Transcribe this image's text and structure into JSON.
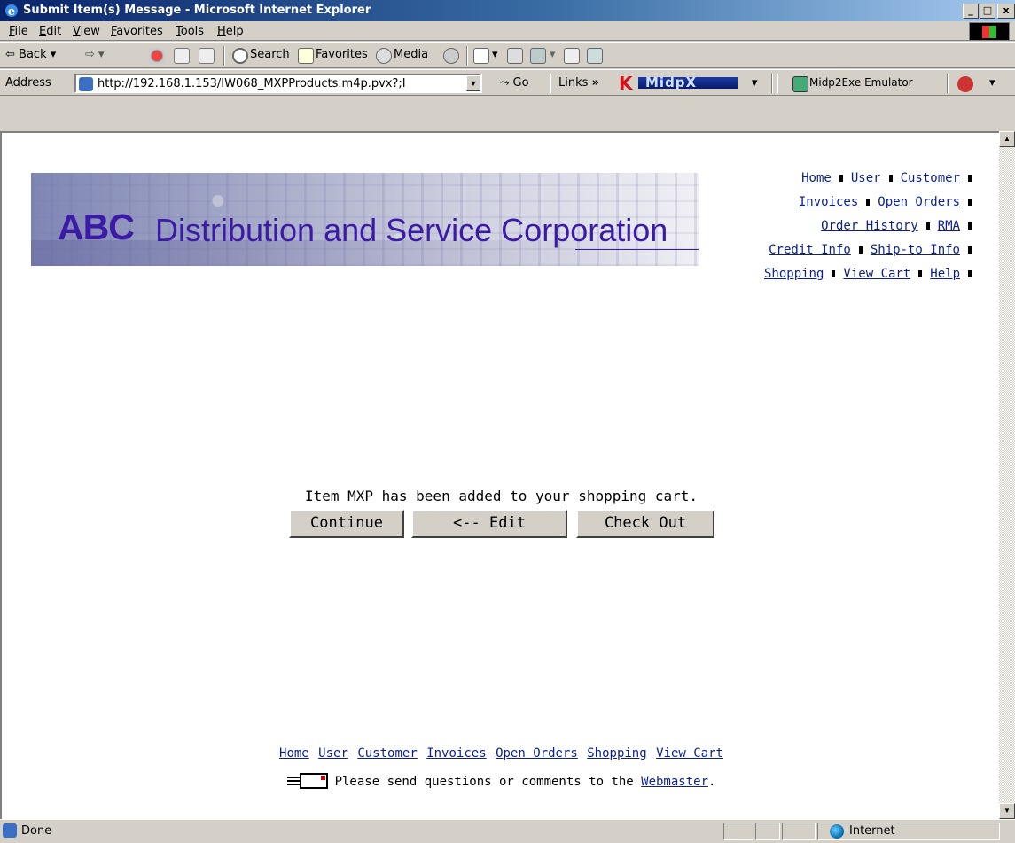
{
  "window": {
    "title": "Submit Item(s) Message - Microsoft Internet Explorer",
    "minimize": "_",
    "maximize": "□",
    "close": "x"
  },
  "menu": [
    "File",
    "Edit",
    "View",
    "Favorites",
    "Tools",
    "Help"
  ],
  "toolbar": {
    "back": "Back",
    "search": "Search",
    "favorites": "Favorites",
    "media": "Media"
  },
  "address": {
    "label": "Address",
    "url": "http://192.168.1.153/IW068_MXPProducts.m4p.pvx?;I",
    "go": "Go",
    "links": "Links",
    "links_more": "»",
    "midpx": "MidpX",
    "midp2exe": "Midp2Exe Emulator"
  },
  "page": {
    "banner_abc": "ABC",
    "banner_rest": "Distribution and Service Corporation",
    "topnav": {
      "row1": [
        "Home",
        "User",
        "Customer"
      ],
      "row2": [
        "Invoices",
        "Open Orders"
      ],
      "row3": [
        "Order History",
        "RMA"
      ],
      "row4": [
        "Credit Info",
        "Ship-to Info"
      ],
      "row5": [
        "Shopping",
        "View Cart",
        "Help"
      ]
    },
    "message": "Item MXP has been added to your shopping cart.",
    "buttons": {
      "continue": "Continue",
      "edit": "<-- Edit",
      "checkout": "Check Out"
    },
    "bottomnav": [
      "Home",
      "User",
      "Customer",
      "Invoices",
      "Open Orders",
      "Shopping",
      "View Cart"
    ],
    "footer_pre": "Please send questions or comments to the ",
    "footer_link": "Webmaster",
    "footer_post": "."
  },
  "status": {
    "text": "Done",
    "zone": "Internet"
  },
  "colors": {
    "title_bar": "#0a246a",
    "banner_text": "#3b1ba6",
    "link": "#0c1f8c",
    "chrome": "#d4d0c8"
  }
}
